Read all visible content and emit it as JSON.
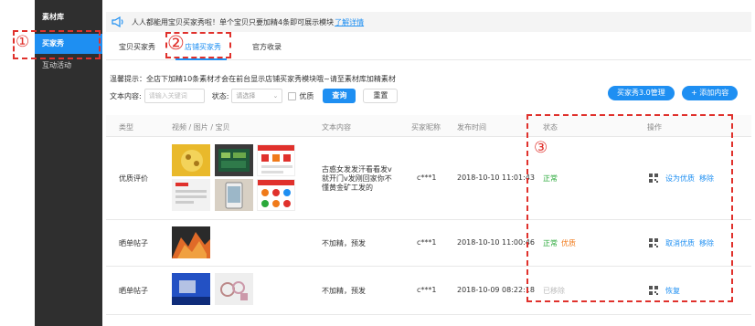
{
  "sidebar": {
    "header": "素材库",
    "items": [
      {
        "label": "买家秀"
      },
      {
        "label": "互动活动"
      }
    ]
  },
  "annotations": [
    "①",
    "②",
    "③"
  ],
  "notice": {
    "text": "人人都能用宝贝买家秀啦！单个宝贝只要加精4条即可展示模块",
    "link": "了解详情"
  },
  "tabs": [
    {
      "label": "宝贝买家秀"
    },
    {
      "label": "店铺买家秀"
    },
    {
      "label": "官方收录"
    }
  ],
  "tip": "温馨提示：全店下加精10条素材才会在前台显示店铺买家秀模块哦~请至素材库加精素材",
  "filter": {
    "text_label": "文本内容:",
    "text_placeholder": "请输入关键词",
    "status_label": "状态:",
    "status_placeholder": "请选择",
    "quality_label": "优质",
    "search_button": "查询",
    "reset_button": "重置"
  },
  "actions": {
    "manage_button": "买家秀3.0管理",
    "add_button": "+ 添加内容"
  },
  "table": {
    "headers": [
      "类型",
      "视频 / 图片 / 宝贝",
      "文本内容",
      "买家昵称",
      "发布时间",
      "状态",
      "操作"
    ],
    "rows": [
      {
        "type": "优质评价",
        "text": "古惑女发发汗看看发v\n就开门v发刚回家你不\n懂黄金矿工发的",
        "nickname": "c***1",
        "time": "2018-10-10 11:01:43",
        "status": [
          "正常"
        ],
        "ops": [
          "设为优质",
          "移除"
        ]
      },
      {
        "type": "晒单帖子",
        "text": "不加精，预发",
        "nickname": "c***1",
        "time": "2018-10-10 11:00:46",
        "status": [
          "正常",
          "优质"
        ],
        "ops": [
          "取消优质",
          "移除"
        ]
      },
      {
        "type": "晒单帖子",
        "text": "不加精，预发",
        "nickname": "c***1",
        "time": "2018-10-09 08:22:18",
        "status": [
          "已移除"
        ],
        "ops": [
          "恢复"
        ]
      }
    ]
  },
  "colors": {
    "primary": "#1e8ff2",
    "annotation": "#e0312c",
    "normal": "#2aa83a",
    "quality": "#f07a1a",
    "sidebar": "#2f2f2f"
  }
}
